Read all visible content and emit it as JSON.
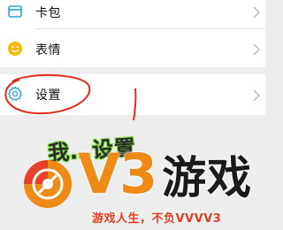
{
  "menu": {
    "top_group": [
      {
        "label": "卡包",
        "icon": "card-wallet-icon"
      },
      {
        "label": "表情",
        "icon": "smiley-icon"
      }
    ],
    "settings": {
      "label": "设置",
      "icon": "gear-icon"
    }
  },
  "annotation": {
    "caption": "我…设置",
    "circle_color": "#e02a1a",
    "caption_outline_color": "#7fe03a"
  },
  "watermark": {
    "brand_primary": "V3",
    "brand_secondary": "游戏",
    "slogan": "游戏人生，不负VVVV3",
    "brand_color": "#f08a16",
    "slogan_color": "#e23a1f"
  }
}
